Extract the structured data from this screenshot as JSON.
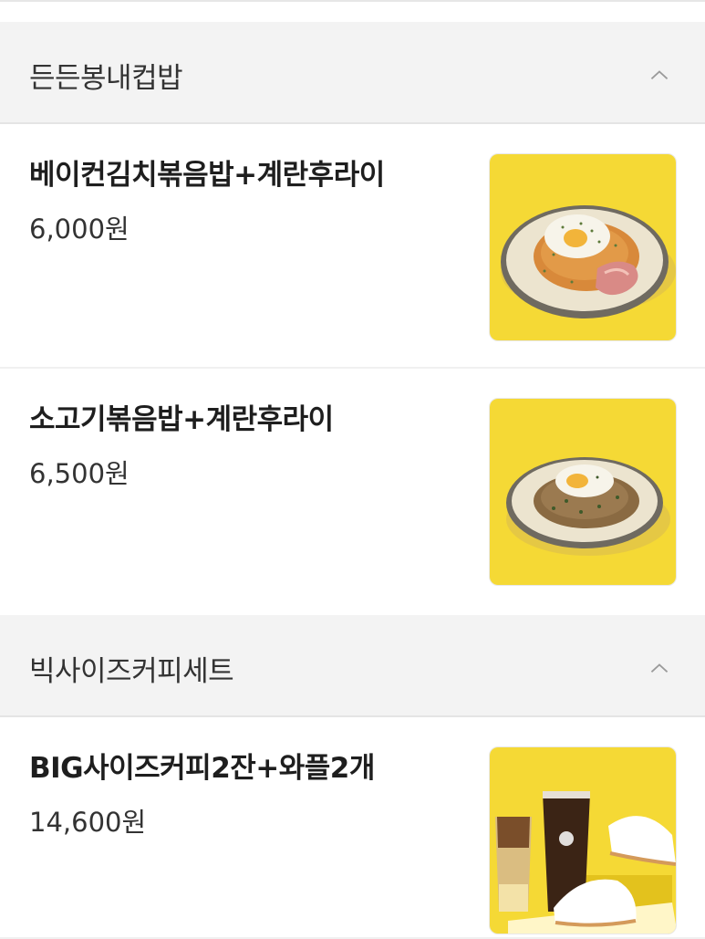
{
  "sections": [
    {
      "title": "든든봉내컵밥",
      "items": [
        {
          "name": "베이컨김치볶음밥+계란후라이",
          "price": "6,000원",
          "image": "bacon-kimchi-fried-rice-photo"
        },
        {
          "name": "소고기볶음밥+계란후라이",
          "price": "6,500원",
          "image": "beef-fried-rice-photo"
        }
      ]
    },
    {
      "title": "빅사이즈커피세트",
      "items": [
        {
          "name": "BIG사이즈커피2잔+와플2개",
          "price": "14,600원",
          "image": "coffee-waffle-set-photo"
        }
      ]
    }
  ],
  "icons": {
    "collapse": "chevron-up-icon"
  },
  "colors": {
    "photo_background": "#f5d935",
    "header_background": "#f3f3f3"
  }
}
